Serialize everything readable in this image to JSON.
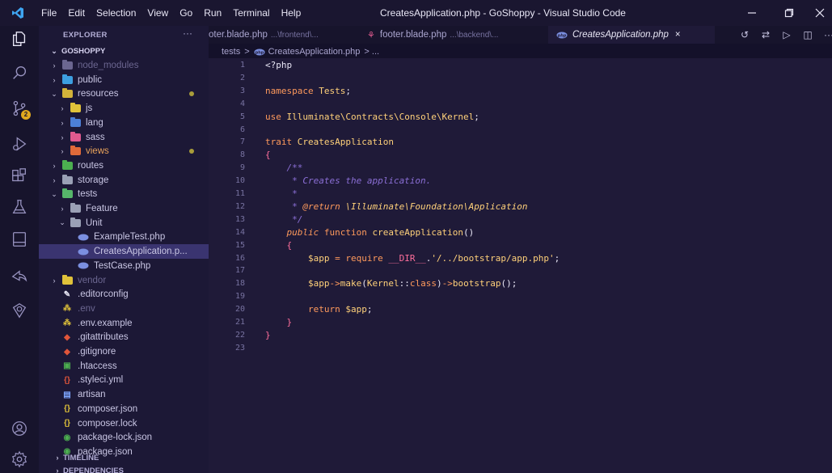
{
  "titlebar": {
    "menu": [
      "File",
      "Edit",
      "Selection",
      "View",
      "Go",
      "Run",
      "Terminal",
      "Help"
    ],
    "window_title": "CreatesApplication.php - GoShoppy - Visual Studio Code"
  },
  "activitybar": {
    "icons": [
      "explorer-icon",
      "search-icon",
      "source-control-icon",
      "run-debug-icon",
      "extensions-icon",
      "testing-icon",
      "remote-explorer-icon",
      "live-share-icon",
      "docker-icon",
      "account-icon",
      "settings-icon"
    ],
    "scm_badge": "2"
  },
  "sidebar": {
    "title": "EXPLORER",
    "more": "···",
    "project": "GOSHOPPY",
    "tree": [
      {
        "label": "node_modules",
        "chev": "›",
        "icon": "folder",
        "color": "#6b6690",
        "indent": 1,
        "dim": true
      },
      {
        "label": "public",
        "chev": "›",
        "icon": "folder",
        "color": "#3d9fe0",
        "indent": 1
      },
      {
        "label": "resources",
        "chev": "⌄",
        "icon": "folder",
        "color": "#d3b33a",
        "indent": 1,
        "modified": true
      },
      {
        "label": "js",
        "chev": "›",
        "icon": "folder",
        "color": "#e0c23a",
        "indent": 2
      },
      {
        "label": "lang",
        "chev": "›",
        "icon": "folder",
        "color": "#4c7fd6",
        "indent": 2
      },
      {
        "label": "sass",
        "chev": "›",
        "icon": "folder",
        "color": "#e05a8f",
        "indent": 2
      },
      {
        "label": "views",
        "chev": "›",
        "icon": "folder",
        "color": "#e06a3a",
        "indent": 2,
        "modified": true,
        "orange": true
      },
      {
        "label": "routes",
        "chev": "›",
        "icon": "folder",
        "color": "#4caf50",
        "indent": 1
      },
      {
        "label": "storage",
        "chev": "›",
        "icon": "folder",
        "color": "#9aa0b5",
        "indent": 1
      },
      {
        "label": "tests",
        "chev": "⌄",
        "icon": "folder",
        "color": "#56b66a",
        "indent": 1
      },
      {
        "label": "Feature",
        "chev": "›",
        "icon": "folder",
        "color": "#9aa0b5",
        "indent": 2
      },
      {
        "label": "Unit",
        "chev": "⌄",
        "icon": "folder",
        "color": "#9aa0b5",
        "indent": 2
      },
      {
        "label": "ExampleTest.php",
        "chev": "",
        "icon": "php",
        "color": "#7b8fe0",
        "indent": 3
      },
      {
        "label": "CreatesApplication.p...",
        "chev": "",
        "icon": "php",
        "color": "#7b8fe0",
        "indent": 3,
        "selected": true
      },
      {
        "label": "TestCase.php",
        "chev": "",
        "icon": "php",
        "color": "#7b8fe0",
        "indent": 3
      },
      {
        "label": "vendor",
        "chev": "›",
        "icon": "folder",
        "color": "#e0c23a",
        "indent": 1,
        "dim": true
      },
      {
        "label": ".editorconfig",
        "chev": "",
        "icon": "editorconfig",
        "color": "#e8e6f5",
        "indent": 1
      },
      {
        "label": ".env",
        "chev": "",
        "icon": "env",
        "color": "#e0c23a",
        "indent": 1,
        "dim": true
      },
      {
        "label": ".env.example",
        "chev": "",
        "icon": "env",
        "color": "#e0c23a",
        "indent": 1
      },
      {
        "label": ".gitattributes",
        "chev": "",
        "icon": "git",
        "color": "#e0553a",
        "indent": 1
      },
      {
        "label": ".gitignore",
        "chev": "",
        "icon": "git",
        "color": "#e0553a",
        "indent": 1
      },
      {
        "label": ".htaccess",
        "chev": "",
        "icon": "htaccess",
        "color": "#4caf50",
        "indent": 1
      },
      {
        "label": ".styleci.yml",
        "chev": "",
        "icon": "yml",
        "color": "#e0553a",
        "indent": 1
      },
      {
        "label": "artisan",
        "chev": "",
        "icon": "file",
        "color": "#7ea6ff",
        "indent": 1
      },
      {
        "label": "composer.json",
        "chev": "",
        "icon": "json",
        "color": "#e0c23a",
        "indent": 1
      },
      {
        "label": "composer.lock",
        "chev": "",
        "icon": "json",
        "color": "#e0c23a",
        "indent": 1
      },
      {
        "label": "package-lock.json",
        "chev": "",
        "icon": "npm",
        "color": "#4caf50",
        "indent": 1
      },
      {
        "label": "package.json",
        "chev": "",
        "icon": "npm",
        "color": "#4caf50",
        "indent": 1
      }
    ],
    "sections": [
      "TIMELINE",
      "DEPENDENCIES"
    ]
  },
  "tabs": [
    {
      "label": "oter.blade.php",
      "path": "...\\frontend\\...",
      "active": false
    },
    {
      "label": "footer.blade.php",
      "path": "...\\backend\\...",
      "active": false
    },
    {
      "label": "CreatesApplication.php",
      "path": "",
      "active": true,
      "close": "×"
    }
  ],
  "breadcrumb": {
    "folder": "tests",
    "sep": ">",
    "file": "CreatesApplication.php",
    "more": "> ..."
  },
  "editor": {
    "line_numbers": [
      "1",
      "2",
      "3",
      "4",
      "5",
      "6",
      "7",
      "8",
      "9",
      "10",
      "11",
      "12",
      "13",
      "14",
      "15",
      "16",
      "17",
      "18",
      "19",
      "20",
      "21",
      "22",
      "23"
    ],
    "lines": [
      [
        {
          "c": "plain",
          "t": "<?php"
        }
      ],
      [],
      [
        {
          "c": "kw",
          "t": "namespace "
        },
        {
          "c": "name",
          "t": "Tests"
        },
        {
          "c": "plain",
          "t": ";"
        }
      ],
      [],
      [
        {
          "c": "kw",
          "t": "use "
        },
        {
          "c": "name",
          "t": "Illuminate\\Contracts\\Console\\Kernel"
        },
        {
          "c": "plain",
          "t": ";"
        }
      ],
      [],
      [
        {
          "c": "kw",
          "t": "trait "
        },
        {
          "c": "name",
          "t": "CreatesApplication"
        }
      ],
      [
        {
          "c": "pink",
          "t": "{"
        }
      ],
      [
        {
          "c": "comment",
          "t": "    /**"
        }
      ],
      [
        {
          "c": "comment",
          "t": "     * Creates the application."
        }
      ],
      [
        {
          "c": "comment",
          "t": "     *"
        }
      ],
      [
        {
          "c": "comment",
          "t": "     * "
        },
        {
          "c": "kw-i",
          "t": "@return "
        },
        {
          "c": "doc",
          "t": "\\Illuminate\\Foundation\\Application"
        }
      ],
      [
        {
          "c": "comment",
          "t": "     */"
        }
      ],
      [
        {
          "c": "kw-i",
          "t": "    public "
        },
        {
          "c": "kw",
          "t": "function "
        },
        {
          "c": "name",
          "t": "createApplication"
        },
        {
          "c": "plain",
          "t": "()"
        }
      ],
      [
        {
          "c": "pink",
          "t": "    {"
        }
      ],
      [
        {
          "c": "var",
          "t": "        $app "
        },
        {
          "c": "kw",
          "t": "= require "
        },
        {
          "c": "const",
          "t": "__DIR__"
        },
        {
          "c": "plain",
          "t": "."
        },
        {
          "c": "str",
          "t": "'/../bootstrap/app.php'"
        },
        {
          "c": "plain",
          "t": ";"
        }
      ],
      [],
      [
        {
          "c": "var",
          "t": "        $app"
        },
        {
          "c": "kw",
          "t": "->"
        },
        {
          "c": "name",
          "t": "make"
        },
        {
          "c": "plain",
          "t": "("
        },
        {
          "c": "name",
          "t": "Kernel"
        },
        {
          "c": "plain",
          "t": "::"
        },
        {
          "c": "kw",
          "t": "class"
        },
        {
          "c": "plain",
          "t": ")"
        },
        {
          "c": "kw",
          "t": "->"
        },
        {
          "c": "name",
          "t": "bootstrap"
        },
        {
          "c": "plain",
          "t": "();"
        }
      ],
      [],
      [
        {
          "c": "kw",
          "t": "        return "
        },
        {
          "c": "var",
          "t": "$app"
        },
        {
          "c": "plain",
          "t": ";"
        }
      ],
      [
        {
          "c": "pink",
          "t": "    }"
        }
      ],
      [
        {
          "c": "pink",
          "t": "}"
        }
      ],
      []
    ]
  }
}
